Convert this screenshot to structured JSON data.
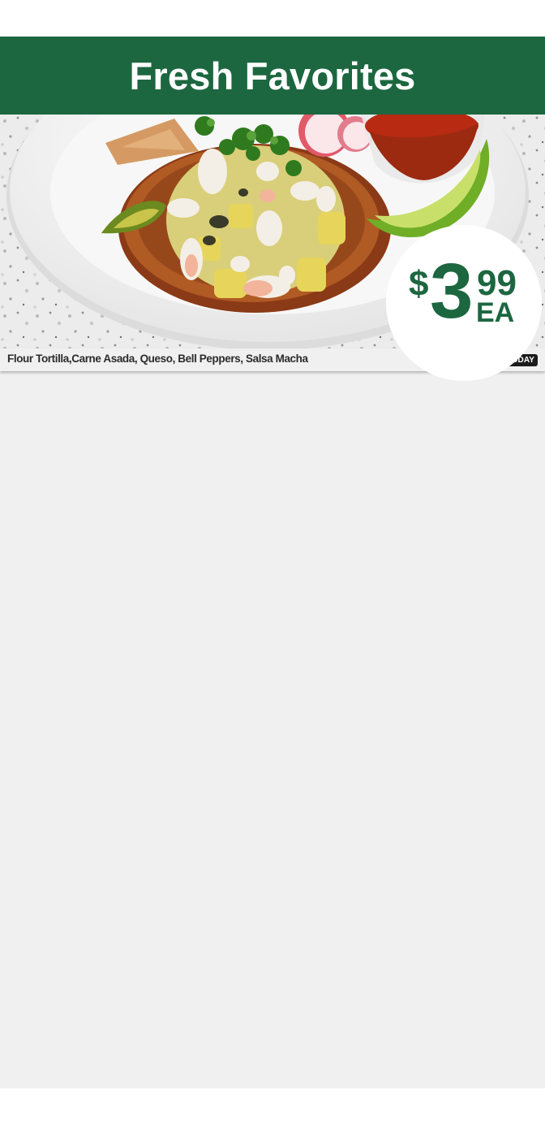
{
  "colors": {
    "brand": "#1c6740",
    "badge_bg": "#1c1c1c",
    "caption_text": "#2b2b2b"
  },
  "header": {
    "title": "Fresh Favorites"
  },
  "promo": {
    "image_icon": "tostada-photo",
    "description": "Flour Tortilla,Carne Asada, Queso, Bell Peppers, Salsa Macha",
    "badge": "ENDS TODAY",
    "price": {
      "currency": "$",
      "dollars": "3",
      "cents": "99",
      "unit": "EA"
    }
  }
}
